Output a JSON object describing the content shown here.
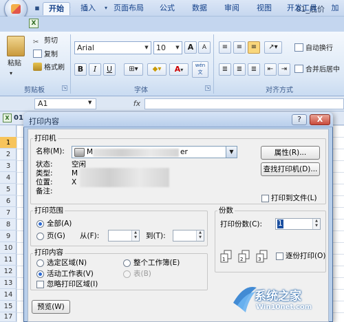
{
  "window": {
    "doc_title": "01_底价"
  },
  "quick_access": [
    "save-icon",
    "undo-icon",
    "redo-icon",
    "print-preview-icon",
    "dropdown-icon"
  ],
  "tabs": [
    {
      "label": "开始",
      "active": true
    },
    {
      "label": "插入"
    },
    {
      "label": "页面布局"
    },
    {
      "label": "公式"
    },
    {
      "label": "数据"
    },
    {
      "label": "审阅"
    },
    {
      "label": "视图"
    },
    {
      "label": "开发工具"
    },
    {
      "label": "加"
    }
  ],
  "ribbon": {
    "clipboard": {
      "paste": "粘贴",
      "cut": "剪切",
      "copy": "复制",
      "format_painter": "格式刷",
      "group_label": "剪贴板"
    },
    "font": {
      "font_name": "Arial",
      "font_size": "10",
      "grow": "A",
      "shrink": "A",
      "bold": "B",
      "italic": "I",
      "underline": "U",
      "font_color_glyph": "A",
      "wen": "wén\n文",
      "group_label": "字体"
    },
    "alignment": {
      "wrap": "自动换行",
      "merge": "合并后居中",
      "group_label": "对齐方式"
    }
  },
  "formula_bar": {
    "cell_ref": "A1",
    "fx": "fx"
  },
  "workbook": {
    "tab_label": "01",
    "row_numbers": [
      "1",
      "2",
      "3",
      "4",
      "5",
      "6",
      "7",
      "8",
      "9",
      "10",
      "11",
      "12",
      "13",
      "14",
      "15",
      "16",
      "17"
    ]
  },
  "dialog": {
    "title": "打印内容",
    "help": "?",
    "close": "X",
    "printer": {
      "group_title": "打印机",
      "name_label": "名称(M):",
      "name_value_start": "M",
      "name_value_end": "er",
      "status_label": "状态:",
      "status_value": "空闲",
      "type_label": "类型:",
      "type_value_start": "M",
      "location_label": "位置:",
      "location_value_start": "X",
      "comment_label": "备注:",
      "properties_button": "属性(R)...",
      "find_printer_button": "查找打印机(D)...",
      "print_to_file": "打印到文件(L)"
    },
    "print_range": {
      "group_title": "打印范围",
      "all": "全部(A)",
      "pages": "页(G)",
      "from_label": "从(F):",
      "to_label": "到(T):"
    },
    "copies": {
      "group_title": "份数",
      "count_label": "打印份数(C):",
      "count_value": "1",
      "collate": "逐份打印(O)"
    },
    "print_what": {
      "group_title": "打印内容",
      "selection": "选定区域(N)",
      "entire_workbook": "整个工作簿(E)",
      "active_sheets": "活动工作表(V)",
      "table": "表(B)",
      "ignore_print_areas": "忽略打印区域(I)"
    },
    "preview_button": "预览(W)"
  },
  "watermark": {
    "title": "系统之家",
    "url": "Win10net.com"
  }
}
